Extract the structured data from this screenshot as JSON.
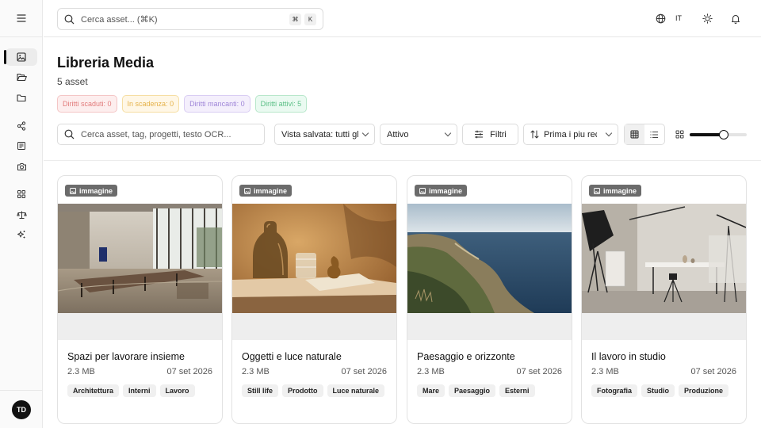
{
  "search": {
    "placeholder": "Cerca asset... (⌘K)",
    "kbd1": "⌘",
    "kbd2": "K"
  },
  "topbar": {
    "language": "IT"
  },
  "user": {
    "initials": "TD"
  },
  "page": {
    "title": "Libreria Media",
    "count": "5 asset"
  },
  "badges": [
    {
      "label": "Diritti scaduti: 0"
    },
    {
      "label": "In scadenza: 0"
    },
    {
      "label": "Diritti mancanti: 0"
    },
    {
      "label": "Diritti attivi: 5"
    }
  ],
  "toolbar": {
    "search_placeholder": "Cerca asset, tag, progetti, testo OCR...",
    "saved_view": "Vista salvata: tutti gli asset",
    "status": "Attivo",
    "filters": "Filtri",
    "sort": "Prima i piu recenti",
    "zoom_level": 0.62
  },
  "cards": [
    {
      "type": "immagine",
      "title": "Spazi per lavorare insieme",
      "size": "2.3 MB",
      "date": "07 set 2026",
      "tags": [
        "Architettura",
        "Interni",
        "Lavoro"
      ]
    },
    {
      "type": "immagine",
      "title": "Oggetti e luce naturale",
      "size": "2.3 MB",
      "date": "07 set 2026",
      "tags": [
        "Still life",
        "Prodotto",
        "Luce naturale"
      ]
    },
    {
      "type": "immagine",
      "title": "Paesaggio e orizzonte",
      "size": "2.3 MB",
      "date": "07 set 2026",
      "tags": [
        "Mare",
        "Paesaggio",
        "Esterni"
      ]
    },
    {
      "type": "immagine",
      "title": "Il lavoro in studio",
      "size": "2.3 MB",
      "date": "07 set 2026",
      "tags": [
        "Fotografia",
        "Studio",
        "Produzione"
      ]
    }
  ]
}
